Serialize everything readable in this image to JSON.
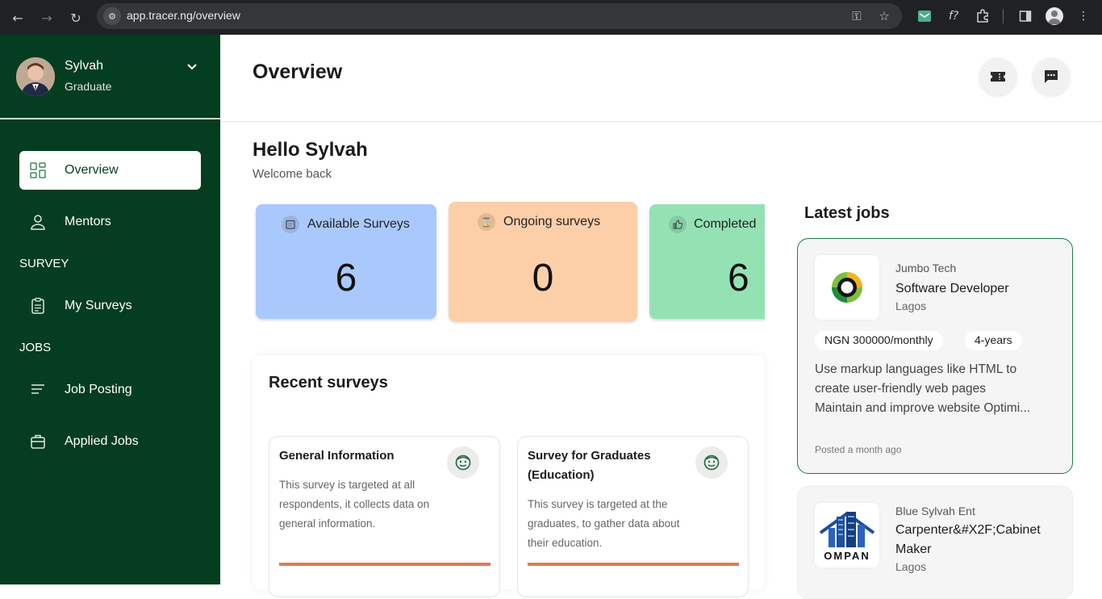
{
  "browser": {
    "url": "app.tracer.ng/overview"
  },
  "sidebar": {
    "user_name": "Sylvah",
    "user_role": "Graduate",
    "items": [
      {
        "label": "Overview",
        "icon": "grid-icon",
        "active": true
      },
      {
        "label": "Mentors",
        "icon": "person-icon",
        "active": false
      },
      {
        "label": "My Surveys",
        "icon": "clipboard-icon",
        "active": false
      },
      {
        "label": "Job Posting",
        "icon": "lines-icon",
        "active": false
      },
      {
        "label": "Applied Jobs",
        "icon": "briefcase-icon",
        "active": false
      }
    ],
    "sections": {
      "survey": "SURVEY",
      "jobs": "JOBS"
    }
  },
  "header": {
    "title": "Overview"
  },
  "greeting": {
    "hello": "Hello Sylvah",
    "welcome": "Welcome back"
  },
  "stats": [
    {
      "label": "Available Surveys",
      "value": "6",
      "color": "#a9c9fd",
      "icon": "calendar-icon"
    },
    {
      "label": "Ongoing surveys",
      "value": "0",
      "color": "#fdcfa8",
      "icon": "hourglass-icon"
    },
    {
      "label": "Completed",
      "value": "6",
      "color": "#94e2b4",
      "icon": "thumbs-up-icon"
    }
  ],
  "recent": {
    "title": "Recent surveys",
    "surveys": [
      {
        "title": "General Information",
        "description": "This survey is targeted at all respondents, it collects data on general information."
      },
      {
        "title": "Survey for Graduates (Education)",
        "description": "This survey is targeted at the graduates, to gather data about their education."
      }
    ]
  },
  "jobs": {
    "title": "Latest jobs",
    "items": [
      {
        "company": "Jumbo Tech",
        "role": "Software Developer",
        "location": "Lagos",
        "salary": "NGN 300000/monthly",
        "experience": "4-years",
        "description_lines": [
          "Use markup languages like HTML to",
          "create user-friendly web pages",
          "Maintain and improve website Optimi..."
        ],
        "posted": "Posted a month ago"
      },
      {
        "company": "Blue Sylvah Ent",
        "role": "Carpenter&#X2F;Cabinet Maker",
        "location": "Lagos",
        "logo_text": "OMPAN"
      }
    ]
  },
  "colors": {
    "sidebar_bg": "#043d1f",
    "accent": "#0b5d2c",
    "progress": "#e07b55"
  }
}
